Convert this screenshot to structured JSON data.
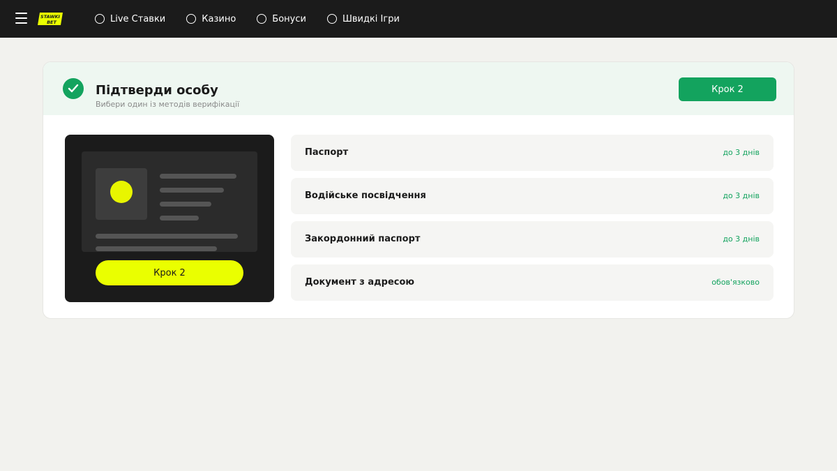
{
  "header": {
    "logo_text": "STAWKI BET",
    "nav": [
      {
        "label": "Live Ставки"
      },
      {
        "label": "Казино"
      },
      {
        "label": "Бонуси"
      },
      {
        "label": "Швидкі Ігри"
      }
    ]
  },
  "card": {
    "title": "Підтверди особу",
    "subtitle": "Вибери один із методів верифікації",
    "step_button": "Крок 2",
    "illustration_button": "Крок 2",
    "options": [
      {
        "label": "Паспорт",
        "value": "до 3 днів"
      },
      {
        "label": "Водійське посвідчення",
        "value": "до 3 днів"
      },
      {
        "label": "Закордонний паспорт",
        "value": "до 3 днів"
      },
      {
        "label": "Документ з адресою",
        "value": "обов'язково"
      }
    ]
  },
  "colors": {
    "accent_green": "#13a35e",
    "accent_yellow": "#eaff00",
    "topbar": "#1b1b1b",
    "background": "#f2f2ee"
  },
  "icons": {
    "menu": "hamburger-icon",
    "logo": "stawki-bet-logo",
    "nav": "circle-icon",
    "verified": "check-circle-icon"
  }
}
